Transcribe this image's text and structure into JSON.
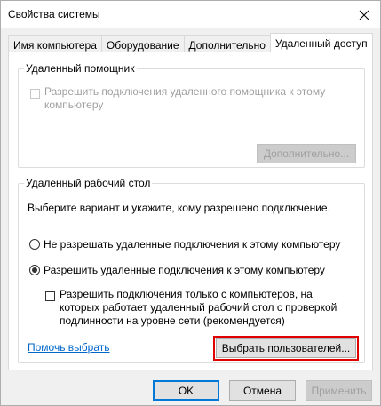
{
  "window": {
    "title": "Свойства системы"
  },
  "tabs": [
    {
      "label": "Имя компьютера"
    },
    {
      "label": "Оборудование"
    },
    {
      "label": "Дополнительно"
    },
    {
      "label": "Удаленный доступ"
    }
  ],
  "remote_assistance": {
    "group_title": "Удаленный помощник",
    "allow_checkbox_label": "Разрешить подключения удаленного помощника к этому компьютеру",
    "advanced_button": "Дополнительно..."
  },
  "remote_desktop": {
    "group_title": "Удаленный рабочий стол",
    "instruction": "Выберите вариант и укажите, кому разрешено подключение.",
    "radio_deny": "Не разрешать удаленные подключения к этому компьютеру",
    "radio_allow": "Разрешить удаленные подключения к этому компьютеру",
    "nla_checkbox_label": "Разрешить подключения только с компьютеров, на которых работает удаленный рабочий стол с проверкой подлинности на уровне сети (рекомендуется)",
    "help_link": "Помочь выбрать",
    "select_users_button": "Выбрать пользователей..."
  },
  "footer": {
    "ok": "OK",
    "cancel": "Отмена",
    "apply": "Применить"
  },
  "state": {
    "selected_tab": "Удаленный доступ",
    "selected_radio": "allow"
  },
  "colors": {
    "accent": "#0078d7",
    "highlight": "#e00000",
    "link": "#0066cc"
  },
  "icons": {
    "close": "close-icon"
  }
}
